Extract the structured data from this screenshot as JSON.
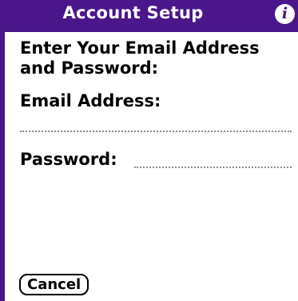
{
  "title_bar": {
    "title": "Account Setup",
    "info_icon_glyph": "i",
    "info_icon": "info-icon"
  },
  "colors": {
    "accent": "#4a168a",
    "background": "#ffffff",
    "text": "#000000",
    "field_underline": "#8c8c8c"
  },
  "form": {
    "instruction": "Enter Your Email Address\nand Password:",
    "email_label": "Email Address:",
    "email_value": "",
    "password_label": "Password:",
    "password_value": ""
  },
  "buttons": {
    "cancel_label": "Cancel"
  }
}
